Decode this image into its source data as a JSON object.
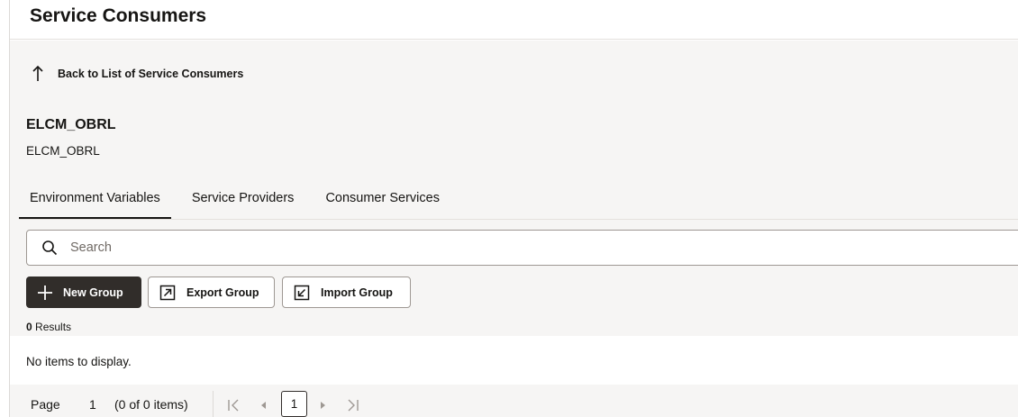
{
  "header": {
    "title": "Service Consumers"
  },
  "back_link": {
    "label": "Back to List of Service Consumers"
  },
  "record": {
    "title": "ELCM_OBRL",
    "subtitle": "ELCM_OBRL"
  },
  "tabs": [
    {
      "label": "Environment Variables",
      "active": true
    },
    {
      "label": "Service Providers",
      "active": false
    },
    {
      "label": "Consumer Services",
      "active": false
    }
  ],
  "search": {
    "placeholder": "Search",
    "value": ""
  },
  "toolbar": {
    "new_group_label": "New Group",
    "export_group_label": "Export Group",
    "import_group_label": "Import Group"
  },
  "results": {
    "count": "0",
    "label": "Results"
  },
  "empty_message": "No items to display.",
  "pagination": {
    "page_label": "Page",
    "page_value": "1",
    "items_summary": "(0 of 0 items)",
    "current_page": "1"
  },
  "icons": {
    "back": "arrow-up-icon",
    "search": "search-icon",
    "new": "plus-icon",
    "export": "export-icon",
    "import": "import-icon",
    "first": "first-page-icon",
    "prev": "prev-page-icon",
    "next": "next-page-icon",
    "last": "last-page-icon"
  },
  "colors": {
    "primary_button": "#312d2a",
    "background": "#f6f5f4",
    "text": "#161513"
  }
}
